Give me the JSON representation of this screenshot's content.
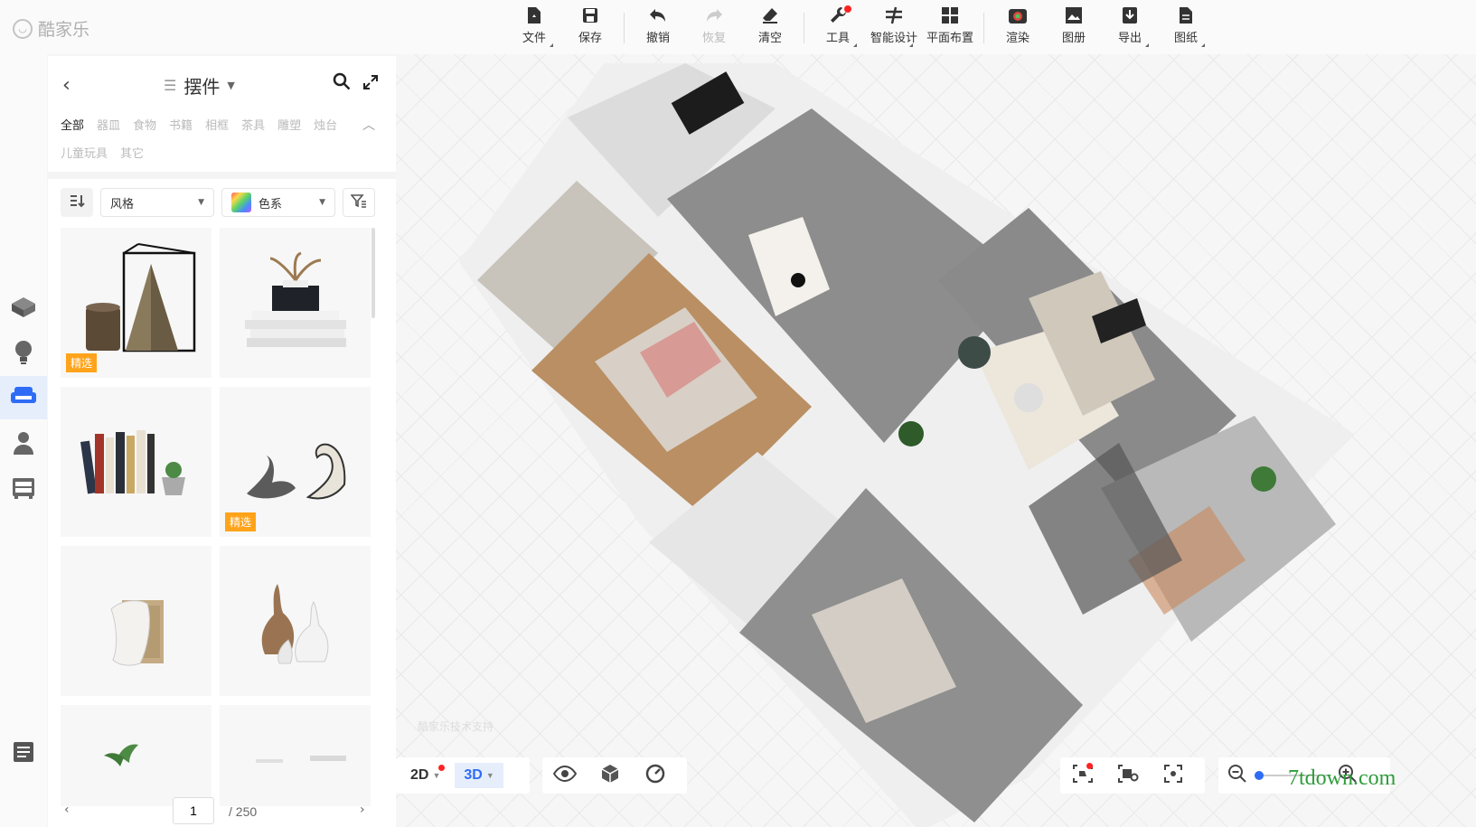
{
  "app": {
    "logo_text": "酷家乐"
  },
  "toolbar": {
    "items": [
      {
        "label": "文件",
        "icon": "file-icon"
      },
      {
        "label": "保存",
        "icon": "save-icon"
      },
      {
        "label": "撤销",
        "icon": "undo-icon"
      },
      {
        "label": "恢复",
        "icon": "redo-icon",
        "disabled": true
      },
      {
        "label": "清空",
        "icon": "eraser-icon"
      },
      {
        "label": "工具",
        "icon": "wrench-icon",
        "notification": true
      },
      {
        "label": "智能设计",
        "icon": "smart-design-icon"
      },
      {
        "label": "平面布置",
        "icon": "floor-layout-icon"
      },
      {
        "label": "渲染",
        "icon": "render-icon"
      },
      {
        "label": "图册",
        "icon": "album-icon"
      },
      {
        "label": "导出",
        "icon": "export-icon"
      },
      {
        "label": "图纸",
        "icon": "drawing-icon"
      }
    ]
  },
  "rail": {
    "items": [
      {
        "icon": "hard-decor-icon"
      },
      {
        "icon": "lighting-icon"
      },
      {
        "icon": "furniture-sofa-icon",
        "active": true
      },
      {
        "icon": "person-icon"
      },
      {
        "icon": "cabinet-icon"
      },
      {
        "icon": "layers-icon"
      }
    ]
  },
  "panel": {
    "title": "摆件",
    "categories": [
      "全部",
      "器皿",
      "食物",
      "书籍",
      "相框",
      "茶具",
      "雕塑",
      "烛台",
      "儿童玩具",
      "其它"
    ],
    "active_category": "全部",
    "filters": {
      "style_label": "风格",
      "color_label": "色系"
    },
    "products": [
      {
        "name": "candle-pyramid-ornament",
        "badge": "精选"
      },
      {
        "name": "books-stack-ornament",
        "badge": ""
      },
      {
        "name": "bookshelf-books-ornament",
        "badge": ""
      },
      {
        "name": "swan-pair-ornament",
        "badge": "精选"
      },
      {
        "name": "towel-basket-ornament",
        "badge": ""
      },
      {
        "name": "ceramic-vase-set-ornament",
        "badge": ""
      },
      {
        "name": "plant-ornament",
        "badge": ""
      },
      {
        "name": "tray-ornament",
        "badge": ""
      }
    ],
    "pager": {
      "current": "1",
      "total": "/ 250"
    }
  },
  "canvas": {
    "watermark": "酷家乐技术支持",
    "view_modes": {
      "mode_2d": "2D",
      "mode_3d": "3D",
      "active": "3D"
    }
  },
  "site_watermark": "7tdown.com",
  "colors": {
    "accent": "#2f6cf6",
    "badge": "#ffa31a",
    "notification": "#ff2222"
  }
}
